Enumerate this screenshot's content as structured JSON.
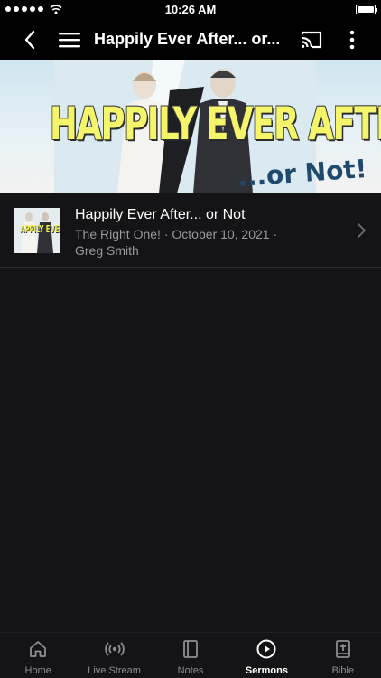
{
  "status_bar": {
    "time": "10:26 AM",
    "signal_bars": 5,
    "battery_level": 1.0
  },
  "nav": {
    "title": "Happily Ever After... or..."
  },
  "banner": {
    "title": "HAPPILY EVER AFTER",
    "subtitle": "...or Not!"
  },
  "sermon": {
    "thumbnail_text": "APPILY EVER AFT",
    "title": "Happily Ever After... or Not",
    "series_date": "The Right One! · October 10, 2021 ·",
    "speaker": "Greg Smith"
  },
  "tabs": [
    {
      "label": "Home",
      "icon": "home-icon",
      "active": false
    },
    {
      "label": "Live Stream",
      "icon": "broadcast-icon",
      "active": false
    },
    {
      "label": "Notes",
      "icon": "notes-icon",
      "active": false
    },
    {
      "label": "Sermons",
      "icon": "play-circle-icon",
      "active": true
    },
    {
      "label": "Bible",
      "icon": "bible-icon",
      "active": false
    }
  ],
  "colors": {
    "background": "#141416",
    "bar": "#000000",
    "secondary_text": "#9a9a9e",
    "tab_inactive": "#8e8e93",
    "banner_title": "#f4f56a",
    "banner_subtitle": "#1f4a6e"
  }
}
